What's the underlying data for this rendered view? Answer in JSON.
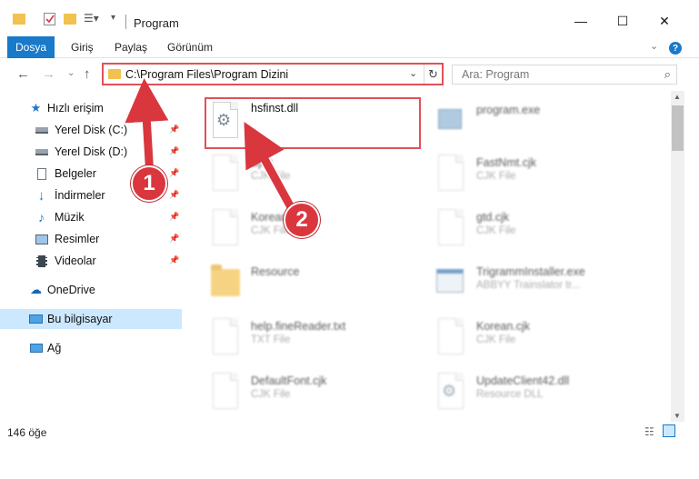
{
  "window": {
    "title": "Program",
    "minimize_glyph": "—",
    "maximize_glyph": "☐",
    "close_glyph": "✕"
  },
  "ribbon": {
    "tabs": [
      "Dosya",
      "Giriş",
      "Paylaş",
      "Görünüm"
    ],
    "help_glyph": "?"
  },
  "address": {
    "path": "C:\\Program Files\\Program Dizini",
    "search_placeholder": "Ara: Program"
  },
  "sidebar": {
    "quick_access": "Hızlı erişim",
    "items": [
      {
        "label": "Yerel Disk (C:)",
        "icon": "drive-icon"
      },
      {
        "label": "Yerel Disk (D:)",
        "icon": "drive-icon"
      },
      {
        "label": "Belgeler",
        "icon": "documents-icon"
      },
      {
        "label": "İndirmeler",
        "icon": "downloads-icon"
      },
      {
        "label": "Müzik",
        "icon": "music-icon"
      },
      {
        "label": "Resimler",
        "icon": "pictures-icon"
      },
      {
        "label": "Videolar",
        "icon": "videos-icon"
      }
    ],
    "onedrive": "OneDrive",
    "this_pc": "Bu bilgisayar",
    "network": "Ağ"
  },
  "files": {
    "highlighted": {
      "name": "hsfinst.dll"
    },
    "left_column": [
      {
        "name": "Bjnk",
        "type": "CJK File"
      },
      {
        "name": "Korean",
        "type": "CJK File"
      },
      {
        "name": "Resource",
        "type": ""
      },
      {
        "name": "help.fineReader.txt",
        "type": "TXT File"
      },
      {
        "name": "DefaultFont.cjk",
        "type": "CJK File"
      }
    ],
    "right_column": [
      {
        "name": "program.exe",
        "type": ""
      },
      {
        "name": "FastNmt.cjk",
        "type": "CJK File"
      },
      {
        "name": "gtd.cjk",
        "type": "CJK File"
      },
      {
        "name": "TrigrammInstaller.exe",
        "type": "ABBYY Trainslator tr..."
      },
      {
        "name": "Korean.cjk",
        "type": "CJK File"
      },
      {
        "name": "UpdateClient42.dll",
        "type": "Resource DLL"
      }
    ]
  },
  "status": {
    "item_count": "146 öğe"
  },
  "callouts": [
    "1",
    "2"
  ],
  "colors": {
    "accent": "#1979ca",
    "highlight_red": "#e05256",
    "callout_red": "#d9363e",
    "selected_bg": "#cce8ff"
  }
}
